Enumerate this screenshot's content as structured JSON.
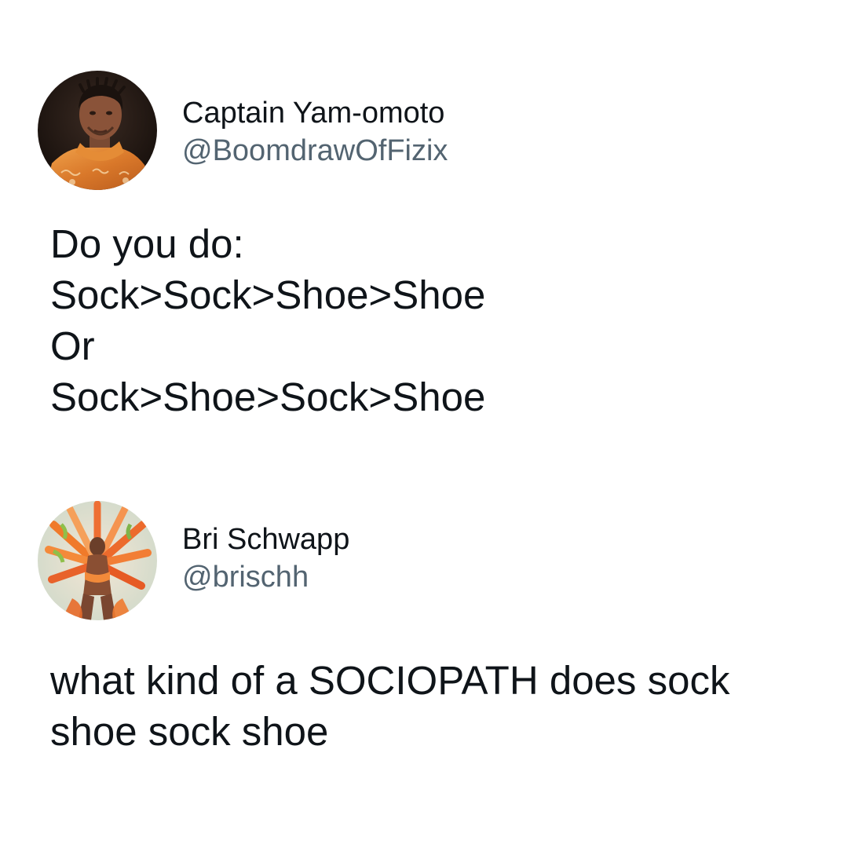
{
  "tweets": [
    {
      "author": {
        "display_name": "Captain Yam-omoto",
        "handle": "@BoomdrawOfFizix",
        "avatar_icon": "portrait-photo"
      },
      "text_lines": [
        "Do you do:",
        "Sock>Sock>Shoe>Shoe",
        "Or",
        "Sock>Shoe>Sock>Shoe"
      ]
    },
    {
      "author": {
        "display_name": "Bri Schwapp",
        "handle": "@brischh",
        "avatar_icon": "carnival-costume-photo"
      },
      "text_lines": [
        "what kind of a SOCIOPATH does sock",
        "shoe sock shoe"
      ]
    }
  ],
  "colors": {
    "background": "#ffffff",
    "text": "#0f1419",
    "handle": "#536471"
  }
}
